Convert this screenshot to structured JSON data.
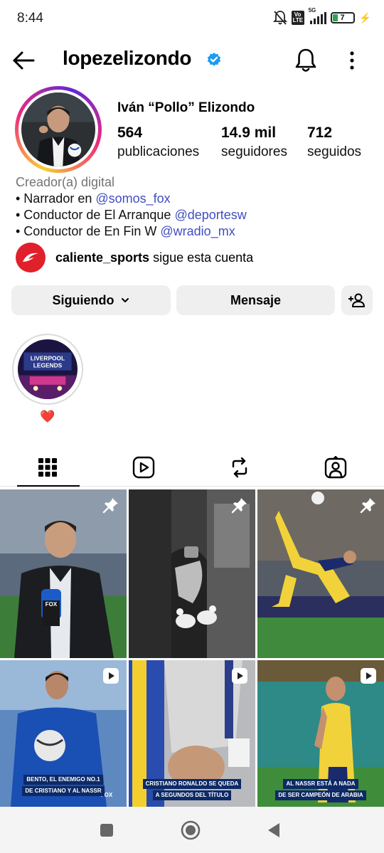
{
  "status_bar": {
    "time": "8:44",
    "network": "5G",
    "volte": "Vo LTE",
    "battery": "7"
  },
  "header": {
    "username": "lopezelizondo",
    "back_icon": "arrow-left-icon",
    "verified_icon": "verified-badge-icon",
    "bell_icon": "bell-icon",
    "more_icon": "more-vertical-icon"
  },
  "profile": {
    "display_name": "Iván “Pollo” Elizondo",
    "stats": [
      {
        "number": "564",
        "label": "publicaciones"
      },
      {
        "number": "14.9 mil",
        "label": "seguidores"
      },
      {
        "number": "712",
        "label": "seguidos"
      }
    ],
    "category": "Creador(a) digital",
    "bio_lines": [
      {
        "prefix": "• Narrador en ",
        "mention": "@somos_fox"
      },
      {
        "prefix": "• Conductor de El Arranque ",
        "mention": "@deportesw"
      },
      {
        "prefix": "• Conductor de En Fin W ",
        "mention": "@wradio_mx"
      }
    ],
    "followed_by": {
      "account": "caliente_sports",
      "text": "sigue esta cuenta"
    }
  },
  "actions": {
    "following_label": "Siguiendo",
    "message_label": "Mensaje",
    "add_user_icon": "add-user-icon"
  },
  "highlights": [
    {
      "label": "❤️",
      "image_text_top": "LIVERPOOL",
      "image_text_bottom": "LEGENDS"
    }
  ],
  "tabs": [
    {
      "name": "grid",
      "icon": "grid-icon",
      "active": true
    },
    {
      "name": "reels",
      "icon": "reels-icon",
      "active": false
    },
    {
      "name": "reposts",
      "icon": "repost-icon",
      "active": false
    },
    {
      "name": "tagged",
      "icon": "tagged-icon",
      "active": false
    }
  ],
  "posts": [
    {
      "type": "pinned",
      "overlay_text": "FOX"
    },
    {
      "type": "pinned"
    },
    {
      "type": "pinned"
    },
    {
      "type": "reel",
      "caption_lines": [
        "BENTO, EL ENEMIGO NO.1",
        "DE CRISTIANO Y AL NASSR"
      ],
      "overlay_text": "FOX"
    },
    {
      "type": "reel",
      "caption_lines": [
        "CRISTIANO RONALDO SE QUEDA",
        "A SEGUNDOS DEL TÍTULO"
      ]
    },
    {
      "type": "reel",
      "caption_lines": [
        "AL NASSR ESTÁ A NADA",
        "DE SER CAMPEÓN DE ARABIA"
      ]
    }
  ],
  "colors": {
    "mention": "#3f4ec0",
    "verified": "#1d9bf0",
    "button_bg": "#efefef",
    "brand_red": "#e0202a"
  },
  "nav": {
    "recents_icon": "square-icon",
    "home_icon": "circle-home-icon",
    "back_icon": "triangle-back-icon"
  }
}
